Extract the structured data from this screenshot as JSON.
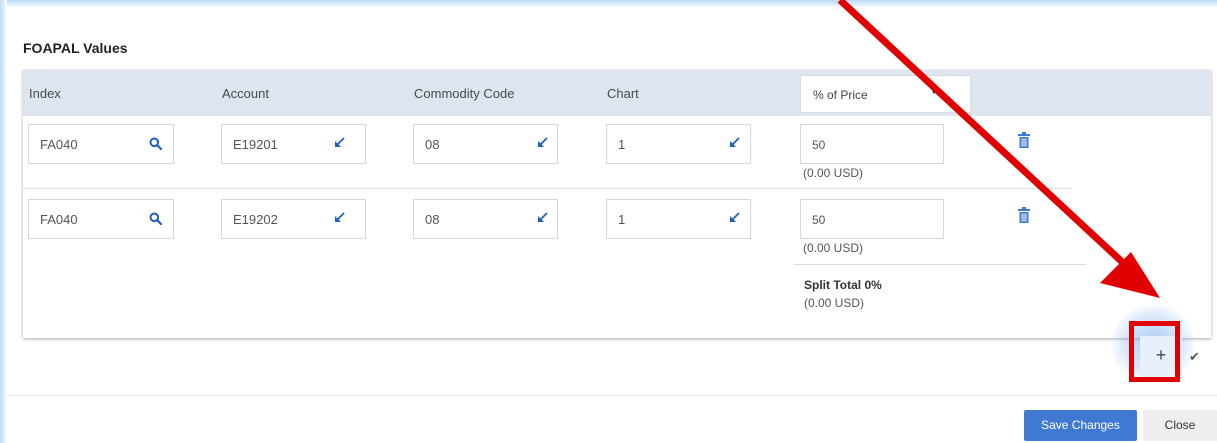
{
  "section": {
    "title": "FOAPAL Values"
  },
  "columns": {
    "index": "Index",
    "account": "Account",
    "commodity": "Commodity Code",
    "chart": "Chart",
    "split_type": "% of Price"
  },
  "rows": [
    {
      "index": "FA040",
      "account": "E19201",
      "commodity": "08",
      "chart": "1",
      "percent": "50",
      "usd": "(0.00 USD)"
    },
    {
      "index": "FA040",
      "account": "E19202",
      "commodity": "08",
      "chart": "1",
      "percent": "50",
      "usd": "(0.00 USD)"
    }
  ],
  "split_total": {
    "label": "Split Total 0%",
    "usd": "(0.00 USD)"
  },
  "actions": {
    "add_label": "+",
    "check_label": "✔",
    "save_label": "Save Changes",
    "close_label": "Close"
  },
  "icons": {
    "search": "search-icon",
    "link": "link-arrow-icon",
    "trash": "trash-icon",
    "dropdown": "dropdown-caret-icon"
  },
  "colors": {
    "accent": "#3f79d1",
    "icon": "#1f5fbf",
    "header_bg": "#dde6ef",
    "annotation": "#e10000"
  }
}
